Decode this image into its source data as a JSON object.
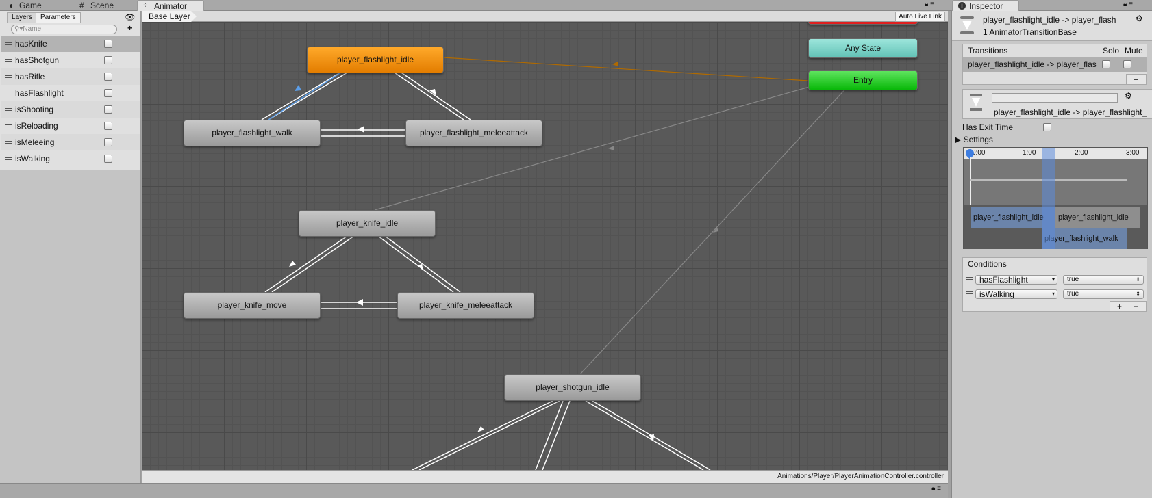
{
  "tabs": [
    {
      "label": "Game",
      "icon": "pacman-icon"
    },
    {
      "label": "Scene",
      "icon": "grid-icon"
    },
    {
      "label": "Animator",
      "icon": "animator-icon",
      "active": true
    },
    {
      "label": "Inspector",
      "icon": "info-icon",
      "active": true
    }
  ],
  "left": {
    "tabs": [
      "Layers",
      "Parameters"
    ],
    "active_tab": "Parameters",
    "search_placeholder": "Name",
    "params": [
      {
        "name": "hasKnife",
        "value": false,
        "selected": true
      },
      {
        "name": "hasShotgun",
        "value": false
      },
      {
        "name": "hasRifle",
        "value": false
      },
      {
        "name": "hasFlashlight",
        "value": false
      },
      {
        "name": "isShooting",
        "value": false
      },
      {
        "name": "isReloading",
        "value": false
      },
      {
        "name": "isMeleeing",
        "value": false
      },
      {
        "name": "isWalking",
        "value": false
      }
    ]
  },
  "toolbar": {
    "breadcrumb": "Base Layer",
    "auto_live_link": "Auto Live Link"
  },
  "graph": {
    "nodes": {
      "flashlight_idle": "player_flashlight_idle",
      "any_state": "Any State",
      "entry": "Entry",
      "flashlight_walk": "player_flashlight_walk",
      "flashlight_melee": "player_flashlight_meleeattack",
      "knife_idle": "player_knife_idle",
      "knife_move": "player_knife_move",
      "knife_melee": "player_knife_meleeattack",
      "shotgun_idle": "player_shotgun_idle"
    },
    "colors": {
      "default_state": "#ee8a00",
      "any_state": "#7fd3c8",
      "entry": "#18c818",
      "exit": "#e02020",
      "selected_transition": "#5c9ee8"
    }
  },
  "status": {
    "path": "Animations/Player/PlayerAnimationController.controller"
  },
  "inspector": {
    "title": "player_flashlight_idle -> player_flash",
    "subtitle": "1 AnimatorTransitionBase",
    "transitions_header": "Transitions",
    "solo": "Solo",
    "mute": "Mute",
    "transition_row": "player_flashlight_idle -> player_flas",
    "minus": "−",
    "transition_name": "player_flashlight_idle -> player_flashlight_",
    "has_exit_time": "Has Exit Time",
    "has_exit_time_value": false,
    "settings": "Settings",
    "timeline": {
      "ticks": [
        "0:00",
        "1:00",
        "2:00",
        "3:00"
      ],
      "clips": [
        "player_flashlight_idle",
        "player_flashlight_idle",
        "player_flashlight_walk"
      ]
    },
    "conditions_header": "Conditions",
    "conditions": [
      {
        "param": "hasFlashlight",
        "value": "true"
      },
      {
        "param": "isWalking",
        "value": "true"
      }
    ],
    "plus": "+",
    "minus2": "−"
  }
}
